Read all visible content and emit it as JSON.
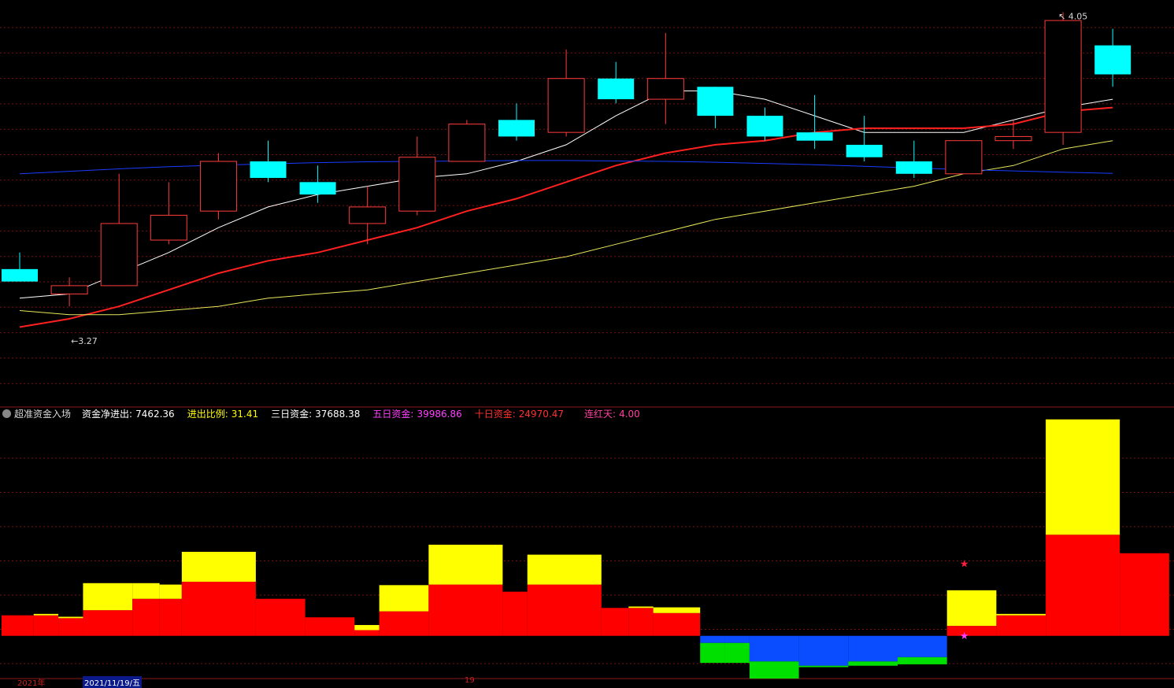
{
  "colors": {
    "background": "#000000",
    "grid": "#7a1212",
    "border": "#8a1a1a",
    "up": "#ff3c3c",
    "down": "#00ffff",
    "ma_white": "#ffffff",
    "ma_red": "#ff2020",
    "ma_yellow": "#e8e85a",
    "ma_blue": "#1a3cff",
    "label": "#d8d8d8"
  },
  "indicator_legend": {
    "icon": "gear-icon",
    "name": "超准资金入场",
    "items": [
      {
        "label": "资金净进出:",
        "value": "7462.36",
        "color": "#ffffff"
      },
      {
        "label": "进出比例:",
        "value": "31.41",
        "color": "#ffff00"
      },
      {
        "label": "三日资金:",
        "value": "37688.38",
        "color": "#ffffff"
      },
      {
        "label": "五日资金:",
        "value": "39986.86",
        "color": "#ff40ff"
      },
      {
        "label": "十日资金:",
        "value": "24970.47",
        "color": "#ff3030"
      },
      {
        "label": "连红天:",
        "value": "4.00",
        "color": "#ff40a0"
      }
    ]
  },
  "bottom_axis": {
    "left_label": "2021年",
    "date_label": "2021/11/19/五",
    "right_mark": "19"
  },
  "chart_data": [
    {
      "type": "candlestick",
      "ylim": [
        3.12,
        4.07
      ],
      "annotations": [
        {
          "text": "3.27",
          "candle": 1,
          "value": 3.27,
          "kind": "low"
        },
        {
          "text": "4.05",
          "candle": 21,
          "value": 4.05,
          "kind": "high"
        }
      ],
      "candles": [
        {
          "open": 3.43,
          "close": 3.4,
          "high": 3.47,
          "low": 3.4
        },
        {
          "open": 3.37,
          "close": 3.39,
          "high": 3.41,
          "low": 3.34
        },
        {
          "open": 3.39,
          "close": 3.54,
          "high": 3.66,
          "low": 3.39
        },
        {
          "open": 3.5,
          "close": 3.56,
          "high": 3.64,
          "low": 3.49
        },
        {
          "open": 3.57,
          "close": 3.69,
          "high": 3.71,
          "low": 3.55
        },
        {
          "open": 3.69,
          "close": 3.65,
          "high": 3.74,
          "low": 3.64
        },
        {
          "open": 3.64,
          "close": 3.61,
          "high": 3.68,
          "low": 3.59
        },
        {
          "open": 3.54,
          "close": 3.58,
          "high": 3.63,
          "low": 3.49
        },
        {
          "open": 3.57,
          "close": 3.7,
          "high": 3.75,
          "low": 3.56
        },
        {
          "open": 3.69,
          "close": 3.78,
          "high": 3.79,
          "low": 3.69
        },
        {
          "open": 3.79,
          "close": 3.75,
          "high": 3.83,
          "low": 3.74
        },
        {
          "open": 3.76,
          "close": 3.89,
          "high": 3.96,
          "low": 3.75
        },
        {
          "open": 3.89,
          "close": 3.84,
          "high": 3.93,
          "low": 3.83
        },
        {
          "open": 3.84,
          "close": 3.89,
          "high": 4.0,
          "low": 3.78
        },
        {
          "open": 3.87,
          "close": 3.8,
          "high": 3.87,
          "low": 3.77
        },
        {
          "open": 3.8,
          "close": 3.75,
          "high": 3.82,
          "low": 3.74
        },
        {
          "open": 3.76,
          "close": 3.74,
          "high": 3.85,
          "low": 3.72
        },
        {
          "open": 3.73,
          "close": 3.7,
          "high": 3.8,
          "low": 3.69
        },
        {
          "open": 3.69,
          "close": 3.66,
          "high": 3.74,
          "low": 3.65
        },
        {
          "open": 3.66,
          "close": 3.74,
          "high": 3.74,
          "low": 3.66
        },
        {
          "open": 3.74,
          "close": 3.75,
          "high": 3.79,
          "low": 3.72
        },
        {
          "open": 3.76,
          "close": 4.03,
          "high": 4.05,
          "low": 3.73
        },
        {
          "open": 3.97,
          "close": 3.9,
          "high": 4.01,
          "low": 3.87
        }
      ],
      "series": [
        {
          "color": "#ffffff",
          "values": [
            3.36,
            3.37,
            3.42,
            3.47,
            3.53,
            3.58,
            3.61,
            3.63,
            3.65,
            3.66,
            3.69,
            3.73,
            3.8,
            3.86,
            3.86,
            3.84,
            3.8,
            3.76,
            3.76,
            3.76,
            3.79,
            3.82,
            3.84
          ]
        },
        {
          "color": "#ff2020",
          "values": [
            3.29,
            3.31,
            3.34,
            3.38,
            3.42,
            3.45,
            3.47,
            3.5,
            3.53,
            3.57,
            3.6,
            3.64,
            3.68,
            3.71,
            3.73,
            3.74,
            3.76,
            3.77,
            3.77,
            3.77,
            3.78,
            3.81,
            3.82
          ]
        },
        {
          "color": "#e8e85a",
          "values": [
            3.33,
            3.32,
            3.32,
            3.33,
            3.34,
            3.36,
            3.37,
            3.38,
            3.4,
            3.42,
            3.44,
            3.46,
            3.49,
            3.52,
            3.55,
            3.57,
            3.59,
            3.61,
            3.63,
            3.66,
            3.68,
            3.72,
            3.74
          ]
        },
        {
          "color": "#1a3cff",
          "values": [
            3.66,
            3.666,
            3.672,
            3.677,
            3.681,
            3.684,
            3.687,
            3.689,
            3.69,
            3.691,
            3.692,
            3.692,
            3.691,
            3.69,
            3.688,
            3.685,
            3.682,
            3.678,
            3.674,
            3.67,
            3.667,
            3.664,
            3.661
          ]
        }
      ]
    },
    {
      "type": "bar",
      "title": "超准资金入场",
      "ylim": [
        -1.5,
        7.4
      ],
      "stars": [
        {
          "index": 19,
          "value": 2.55,
          "color": "#ff2040"
        },
        {
          "index": 19,
          "value": 0.02,
          "color": "#ff40ff"
        }
      ],
      "segments": [
        {
          "start": 0,
          "end": 0.65,
          "red": 0.72,
          "yellow": 0,
          "blue": 0,
          "green": 0
        },
        {
          "start": 0.65,
          "end": 1.15,
          "red": 0.72,
          "yellow": 0.05,
          "blue": 0,
          "green": 0
        },
        {
          "start": 1.15,
          "end": 1.65,
          "red": 0.62,
          "yellow": 0.05,
          "blue": 0,
          "green": 0
        },
        {
          "start": 1.65,
          "end": 2.65,
          "red": 0.9,
          "yellow": 0.95,
          "blue": 0,
          "green": 0
        },
        {
          "start": 2.65,
          "end": 3.2,
          "red": 1.3,
          "yellow": 0.55,
          "blue": 0,
          "green": 0
        },
        {
          "start": 3.2,
          "end": 3.65,
          "red": 1.3,
          "yellow": 0.5,
          "blue": 0,
          "green": 0
        },
        {
          "start": 3.65,
          "end": 5.15,
          "red": 1.9,
          "yellow": 1.05,
          "blue": 0,
          "green": 0
        },
        {
          "start": 5.15,
          "end": 6.15,
          "red": 1.3,
          "yellow": 0,
          "blue": 0,
          "green": 0
        },
        {
          "start": 6.15,
          "end": 7.15,
          "red": 0.65,
          "yellow": 0,
          "blue": 0,
          "green": 0
        },
        {
          "start": 7.15,
          "end": 7.65,
          "red": 0.2,
          "yellow": 0.18,
          "blue": 0,
          "green": 0
        },
        {
          "start": 7.65,
          "end": 8.65,
          "red": 0.86,
          "yellow": 0.92,
          "blue": 0,
          "green": 0
        },
        {
          "start": 8.65,
          "end": 10.15,
          "red": 1.8,
          "yellow": 1.4,
          "blue": 0,
          "green": 0
        },
        {
          "start": 10.15,
          "end": 10.65,
          "red": 1.55,
          "yellow": 0,
          "blue": 0,
          "green": 0
        },
        {
          "start": 10.65,
          "end": 12.15,
          "red": 1.8,
          "yellow": 1.05,
          "blue": 0,
          "green": 0
        },
        {
          "start": 12.15,
          "end": 12.7,
          "red": 0.98,
          "yellow": 0,
          "blue": 0,
          "green": 0
        },
        {
          "start": 12.7,
          "end": 13.2,
          "red": 0.98,
          "yellow": 0.05,
          "blue": 0,
          "green": 0
        },
        {
          "start": 13.2,
          "end": 14.15,
          "red": 0.8,
          "yellow": 0.2,
          "blue": 0,
          "green": 0
        },
        {
          "start": 14.15,
          "end": 14.65,
          "red": 0,
          "yellow": 0,
          "blue": -0.25,
          "green": -0.7
        },
        {
          "start": 14.65,
          "end": 15.15,
          "red": 0,
          "yellow": 0,
          "blue": -0.25,
          "green": -0.7
        },
        {
          "start": 15.15,
          "end": 16.15,
          "red": 0,
          "yellow": 0,
          "blue": -0.9,
          "green": -0.6
        },
        {
          "start": 16.15,
          "end": 17.15,
          "red": 0,
          "yellow": 0,
          "blue": -1.05,
          "green": -0.05
        },
        {
          "start": 17.15,
          "end": 18.15,
          "red": 0,
          "yellow": 0,
          "blue": -0.9,
          "green": -0.15
        },
        {
          "start": 18.15,
          "end": 19.15,
          "red": 0,
          "yellow": 0,
          "blue": -0.75,
          "green": -0.25
        },
        {
          "start": 19.15,
          "end": 20.15,
          "red": 0.35,
          "yellow": 1.25,
          "blue": 0,
          "green": 0
        },
        {
          "start": 20.15,
          "end": 21.15,
          "red": 0.72,
          "yellow": 0.05,
          "blue": 0,
          "green": 0
        },
        {
          "start": 21.15,
          "end": 22.65,
          "red": 3.55,
          "yellow": 4.05,
          "blue": 0,
          "green": 0
        },
        {
          "start": 22.65,
          "end": 23.65,
          "red": 2.9,
          "yellow": 0,
          "blue": 0,
          "green": 0
        }
      ]
    }
  ]
}
